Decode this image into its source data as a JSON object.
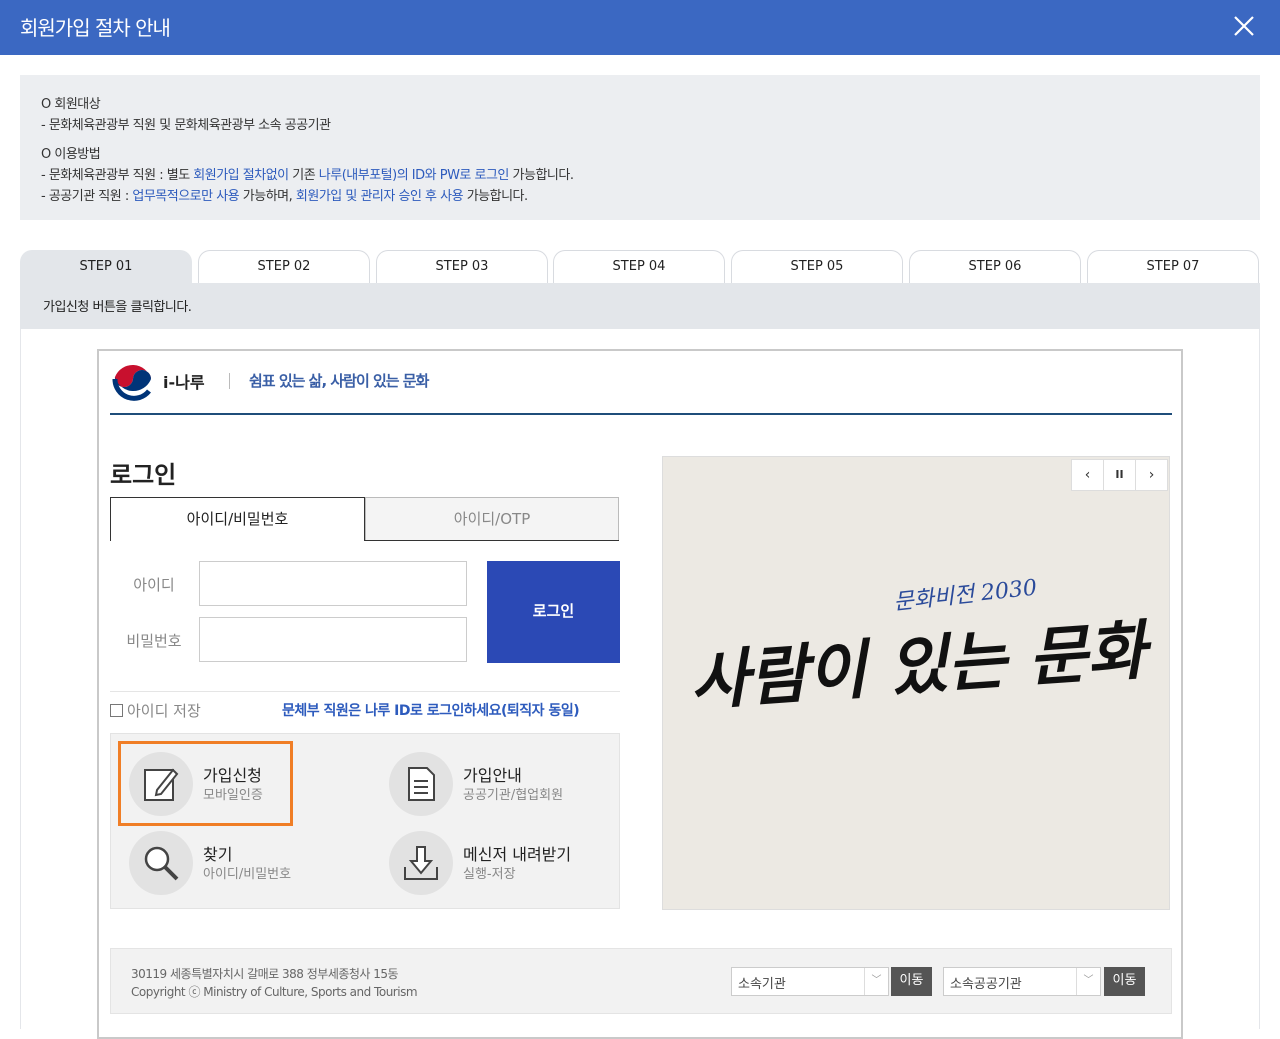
{
  "header": {
    "title": "회원가입 절차 안내"
  },
  "info": {
    "target_heading": "O 회원대상",
    "target_text": "- 문화체육관광부 직원 및 문화체육관광부 소속 공공기관",
    "method_heading": "O 이용방법",
    "line1_a": "- 문화체육관광부 직원 : 별도 ",
    "line1_b": "회원가입 절차없이",
    "line1_c": " 기존 ",
    "line1_d": "나루(내부포털)의 ID와 PW로 로그인",
    "line1_e": " 가능합니다.",
    "line2_a": "- 공공기관 직원 : ",
    "line2_b": "업무목적으로만 사용",
    "line2_c": " 가능하며, ",
    "line2_d": "회원가입 및 관리자 승인 후 사용",
    "line2_e": " 가능합니다."
  },
  "tabs": [
    "STEP 01",
    "STEP 02",
    "STEP 03",
    "STEP 04",
    "STEP 05",
    "STEP 06",
    "STEP 07"
  ],
  "step_description": "가입신청 버튼을 클릭합니다.",
  "site": {
    "logo_name": "i-나루",
    "slogan": "쉼표 있는 삶, 사람이 있는 문화",
    "login_heading": "로그인",
    "login_tabs": [
      "아이디/비밀번호",
      "아이디/OTP"
    ],
    "id_label": "아이디",
    "pw_label": "비밀번호",
    "login_button": "로그인",
    "save_id": "아이디 저장",
    "notice": "문체부 직원은 나루 ID로 로그인하세요(퇴직자 동일)",
    "quick": [
      {
        "title": "가입신청",
        "sub": "모바일인증",
        "icon": "edit-document-icon"
      },
      {
        "title": "가입안내",
        "sub": "공공기관/협업회원",
        "icon": "document-icon"
      },
      {
        "title": "찾기",
        "sub": "아이디/비밀번호",
        "icon": "magnifier-icon"
      },
      {
        "title": "메신저 내려받기",
        "sub": "실행-저장",
        "icon": "download-icon"
      }
    ],
    "banner": {
      "small_text": "문화비전 2030",
      "main_text": "사람이 있는 문화",
      "controls": [
        "‹",
        "II",
        "›"
      ]
    },
    "footer": {
      "address": "30119 세종특별자치시 갈매로 388 정부세종청사 15동",
      "copyright": "Copyright ⓒ Ministry of Culture, Sports and Tourism",
      "select1": "소속기관",
      "select2": "소속공공기관",
      "go": "이동"
    }
  }
}
